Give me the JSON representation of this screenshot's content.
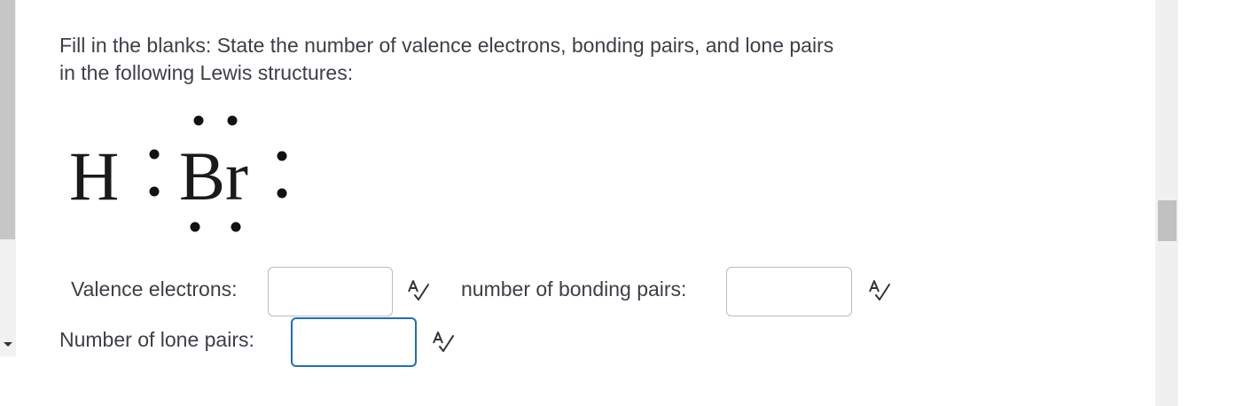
{
  "question": {
    "line1": "Fill in the blanks: State the number of valence electrons, bonding pairs, and lone pairs",
    "line2": "in  the following Lewis structures:"
  },
  "structure": {
    "atom1": "H",
    "atom2": "Br",
    "bond_electrons": 2,
    "lone_pairs_on_br": 3
  },
  "fields": {
    "valence_label": "Valence electrons:",
    "valence_value": "",
    "bonding_label": "number of bonding pairs:",
    "bonding_value": "",
    "lone_label": "Number of lone pairs:",
    "lone_value": ""
  },
  "icons": {
    "spellcheck": "spellcheck-icon"
  },
  "colors": {
    "focus_border": "#1f6fb5",
    "text": "#3d3f47"
  }
}
